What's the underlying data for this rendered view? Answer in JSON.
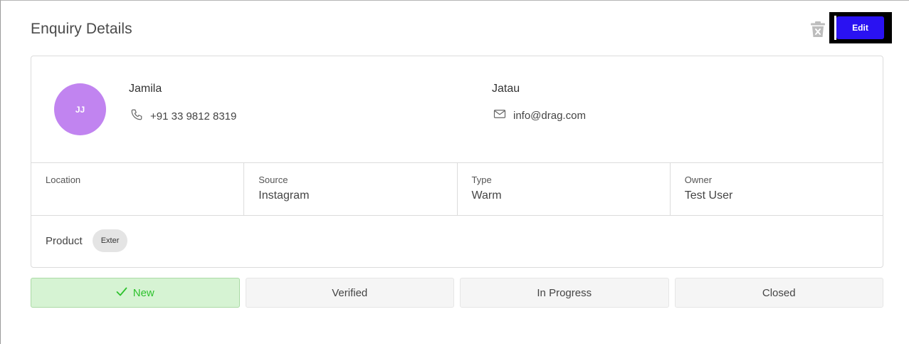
{
  "page": {
    "title": "Enquiry Details"
  },
  "toolbar": {
    "edit_label": "Edit"
  },
  "icons": {
    "trash": "trash-icon",
    "phone": "phone-icon",
    "email": "mail-icon",
    "check": "check-icon"
  },
  "contact": {
    "initials": "JJ",
    "first_name": "Jamila",
    "last_name": "Jatau",
    "phone": "+91 33 9812 8319",
    "email": "info@drag.com"
  },
  "details": [
    {
      "label": "Location",
      "value": ""
    },
    {
      "label": "Source",
      "value": "Instagram"
    },
    {
      "label": "Type",
      "value": "Warm"
    },
    {
      "label": "Owner",
      "value": "Test User"
    }
  ],
  "product": {
    "label": "Product",
    "chips": [
      "Exter"
    ]
  },
  "status": {
    "steps": [
      {
        "label": "New",
        "active": true
      },
      {
        "label": "Verified",
        "active": false
      },
      {
        "label": "In Progress",
        "active": false
      },
      {
        "label": "Closed",
        "active": false
      }
    ]
  },
  "colors": {
    "accent": "#2a12f2",
    "avatar": "#c184f0",
    "active_step_bg": "#d6f3d3",
    "active_step_text": "#2ec22e"
  }
}
